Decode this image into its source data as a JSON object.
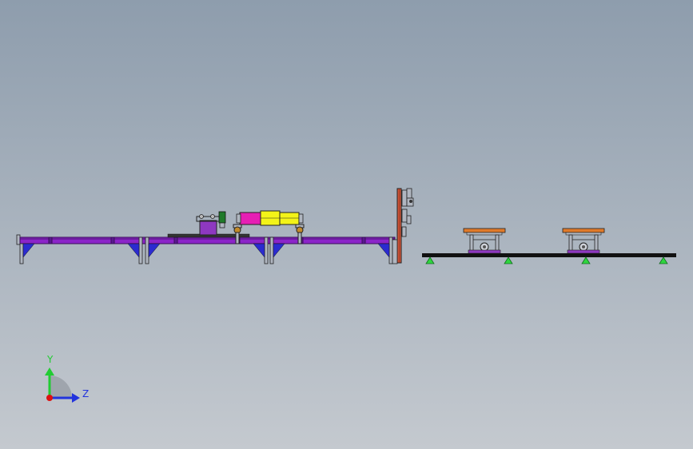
{
  "viewport": {
    "background_top": "#8e9dad",
    "background_bottom": "#c4c9cf"
  },
  "colors": {
    "conveyor_frame": "#8b24c9",
    "conveyor_edge": "#3a1058",
    "support_brace": "#2b2bd0",
    "column": "#b0b6c0",
    "module_magenta": "#e61fb4",
    "module_yellow": "#f3f318",
    "motor_green": "#1f7a2a",
    "motor_body": "#8e38c0",
    "rail_orange": "#d2563a",
    "base_rail": "#111111",
    "foot_green": "#2fd63f",
    "fixture_top": "#e07a2a",
    "outline": "#222222"
  },
  "triad": {
    "y_label": "Y",
    "z_label": "Z",
    "y_color": "#22cc33",
    "z_color": "#2233dd",
    "origin_color": "#dd1111"
  }
}
